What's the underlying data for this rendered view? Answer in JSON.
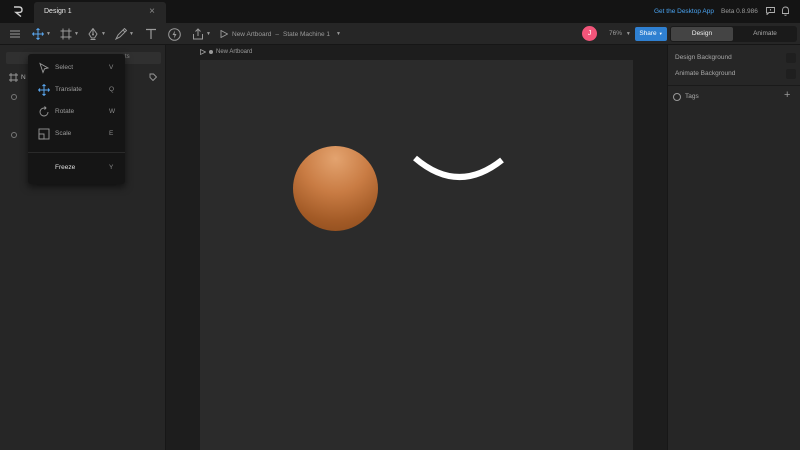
{
  "titlebar": {
    "tab_title": "Design 1",
    "close_glyph": "×",
    "desktop_link": "Get the Desktop App",
    "version": "Beta 0.8.986"
  },
  "toolbar": {
    "breadcrumb_artboard": "New Artboard",
    "breadcrumb_sep": "–",
    "breadcrumb_state_machine": "State Machine 1",
    "zoom": "76%",
    "share_label": "Share",
    "avatar_initial": "J",
    "design_tab": "Design",
    "animate_tab": "Animate"
  },
  "transform_menu": {
    "items": [
      {
        "label": "Select",
        "key": "V",
        "icon": "select-arrow-icon"
      },
      {
        "label": "Translate",
        "key": "Q",
        "icon": "translate-arrows-icon"
      },
      {
        "label": "Rotate",
        "key": "W",
        "icon": "rotate-icon"
      },
      {
        "label": "Scale",
        "key": "E",
        "icon": "scale-icon"
      }
    ],
    "freeze_label": "Freeze",
    "freeze_key": "Y"
  },
  "left_panel": {
    "tab_fragment": "ts",
    "artboard_row": "N"
  },
  "canvas": {
    "artboard_label": "New Artboard"
  },
  "right_panel": {
    "design_background": "Design Background",
    "animate_background": "Animate Background",
    "tags_label": "Tags",
    "add_glyph": "+"
  },
  "colors": {
    "accent_blue": "#2f80d1",
    "avatar_pink": "#f2557a",
    "ball_orange": "#c97c44"
  }
}
